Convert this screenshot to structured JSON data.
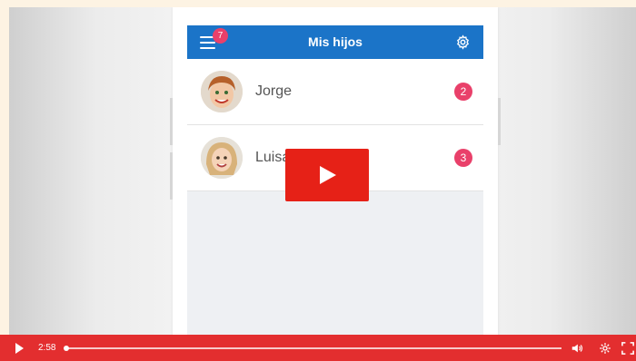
{
  "app": {
    "title": "Mis hijos",
    "menu_badge": "7"
  },
  "children": [
    {
      "name": "Jorge",
      "count": "2"
    },
    {
      "name": "Luisa",
      "count": "3"
    }
  ],
  "player": {
    "time": "2:58",
    "progress": 0.0
  },
  "colors": {
    "appbar": "#1b74c8",
    "badge": "#e9406a",
    "player_red": "#e32e2f",
    "play_button": "#e62117"
  },
  "icons": [
    "menu-icon",
    "gear-icon",
    "play-icon",
    "volume-icon",
    "settings-icon",
    "fullscreen-icon"
  ]
}
